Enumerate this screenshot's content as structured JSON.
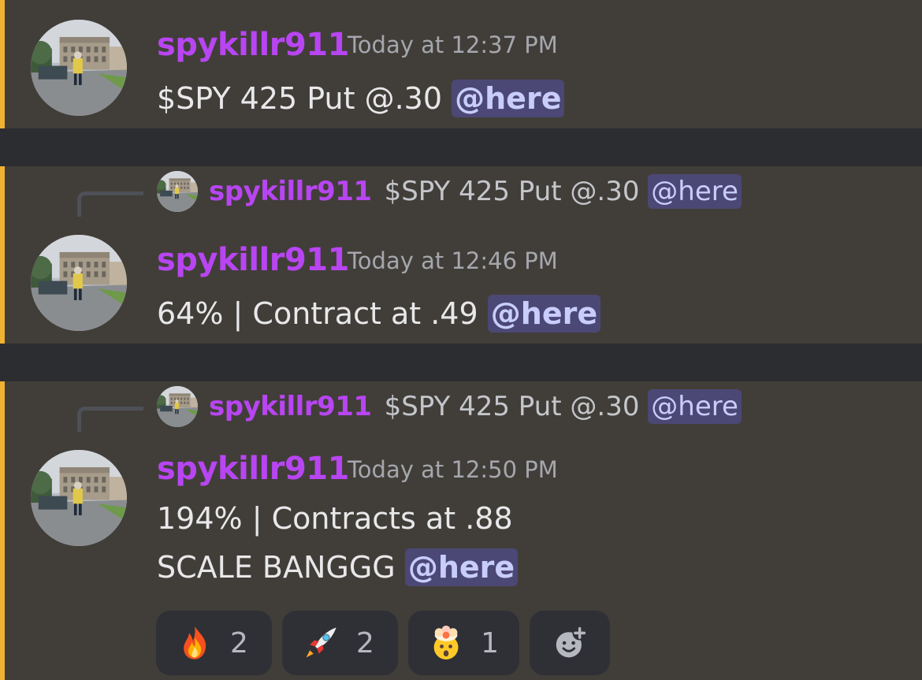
{
  "messages": [
    {
      "username": "spykillr911",
      "timestamp": "Today at 12:37 PM",
      "lines": [
        "$SPY 425 Put @.30"
      ],
      "mention": "@here"
    },
    {
      "reply": {
        "username": "spykillr911",
        "text": "$SPY 425 Put @.30",
        "mention": "@here"
      },
      "username": "spykillr911",
      "timestamp": "Today at 12:46 PM",
      "lines": [
        "64% | Contract at .49"
      ],
      "mention": "@here"
    },
    {
      "reply": {
        "username": "spykillr911",
        "text": "$SPY 425 Put @.30",
        "mention": "@here"
      },
      "username": "spykillr911",
      "timestamp": "Today at 12:50 PM",
      "lines": [
        "194% | Contracts at .88",
        "SCALE BANGGG"
      ],
      "mention": "@here",
      "reactions": [
        {
          "emoji": "fire-emoji",
          "count": "2"
        },
        {
          "emoji": "rocket-emoji",
          "count": "2"
        },
        {
          "emoji": "exploding-head-emoji",
          "count": "1"
        }
      ]
    }
  ],
  "colors": {
    "username": "#b845f2",
    "highlight_bar": "#f0b232",
    "message_bg": "#413e39",
    "gap_bg": "#2b2d31",
    "mention_bg": "#4b4875",
    "mention_text": "#c9cdfb"
  },
  "icons": {
    "add_reaction": "add-reaction-icon"
  }
}
